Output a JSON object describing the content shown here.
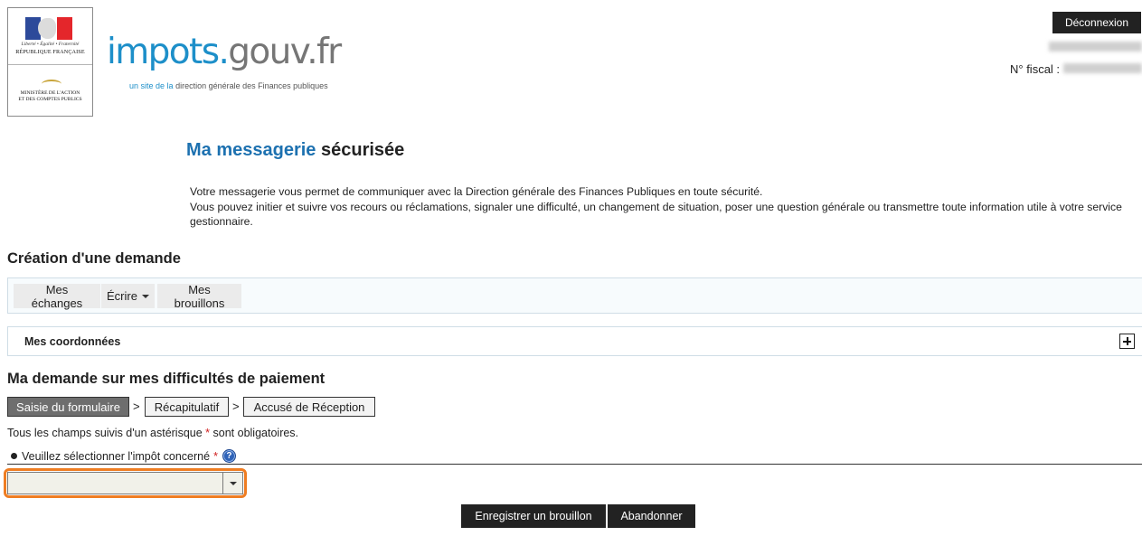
{
  "header": {
    "logo": {
      "devise": "Liberté • Égalité • Fraternité",
      "republique": "RÉPUBLIQUE FRANÇAISE",
      "ministere_line1": "MINISTÈRE DE L'ACTION",
      "ministere_line2": "ET DES COMPTES PUBLICS"
    },
    "brand_part1": "impots.",
    "brand_part2": "gouv.fr",
    "brand_sub_prefix": "un site de la",
    "brand_sub_text": "direction générale des Finances publiques",
    "logout_label": "Déconnexion",
    "fiscal_label": "N° fiscal :"
  },
  "page": {
    "title_accent": "Ma messagerie",
    "title_rest": "sécurisée",
    "intro_line1": "Votre messagerie vous permet de communiquer avec la Direction générale des Finances Publiques en toute sécurité.",
    "intro_line2": "Vous pouvez initier et suivre vos recours ou réclamations, signaler une difficulté, un changement de situation, poser une question générale ou transmettre toute information utile à votre service gestionnaire."
  },
  "creation": {
    "heading": "Création d'une demande",
    "nav": {
      "exchanges": "Mes échanges",
      "write": "Écrire",
      "drafts": "Mes brouillons"
    }
  },
  "coordonnees": {
    "title": "Mes coordonnées",
    "expand_icon": "plus-square-icon"
  },
  "demande": {
    "heading": "Ma demande sur mes difficultés de paiement",
    "steps": [
      "Saisie du formulaire",
      "Récapitulatif",
      "Accusé de Réception"
    ],
    "step_separator": ">",
    "required_note_before": "Tous les champs suivis d'un astérisque",
    "required_star": "*",
    "required_note_after": "sont obligatoires.",
    "field_label": "Veuillez sélectionner l'impôt concerné",
    "field_star": "*",
    "help_icon": "?",
    "select_value": ""
  },
  "actions": {
    "save_draft": "Enregistrer un brouillon",
    "abandon": "Abandonner"
  },
  "colors": {
    "brand_blue": "#1d8fc9",
    "title_blue": "#1d71b0",
    "focus_orange": "#ef7d22",
    "button_dark": "#222222"
  }
}
